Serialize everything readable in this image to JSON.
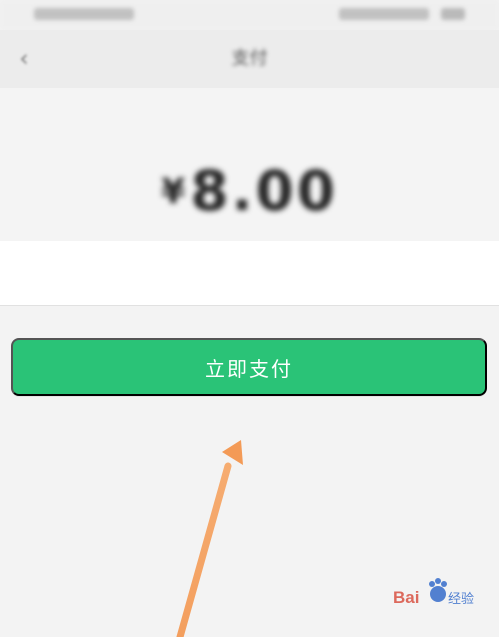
{
  "status_bar": {
    "left_text": "",
    "right_text": ""
  },
  "nav": {
    "back_icon": "back-arrow-icon",
    "title": "支付"
  },
  "summary": {
    "description": "",
    "currency": "¥",
    "amount": "8.00"
  },
  "payment_method": {
    "label": "",
    "value": ""
  },
  "pay_button": {
    "label": "立即支付"
  },
  "colors": {
    "accent": "#2ac377",
    "arrow": "#f39a56",
    "watermark_red": "#d84b3c",
    "watermark_blue": "#2f68c9"
  },
  "watermark": {
    "text": "Baidu 经验",
    "icon": "baidu-paw-logo"
  }
}
